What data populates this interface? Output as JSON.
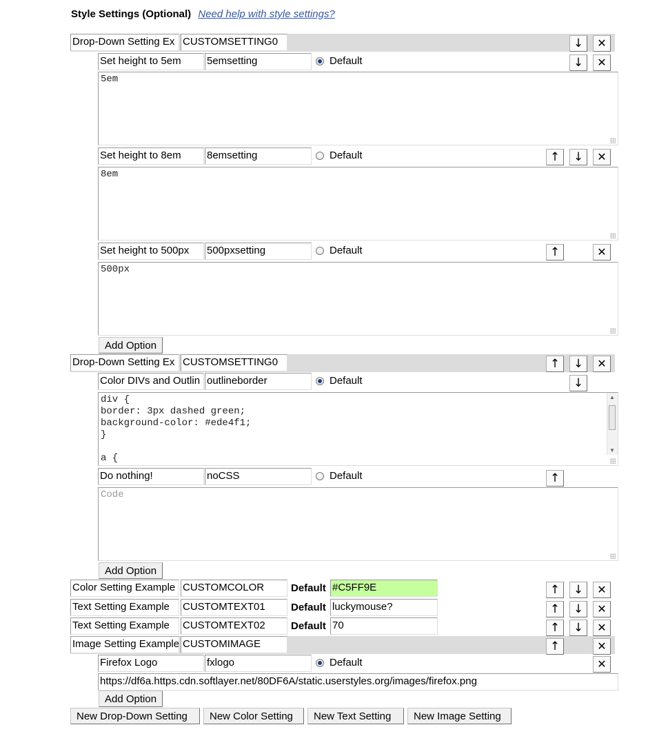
{
  "header": {
    "title": "Style Settings (Optional)",
    "help_link": "Need help with style settings?"
  },
  "dropdown1": {
    "label": "Drop-Down Setting Ex",
    "key": "CUSTOMSETTING0",
    "options": [
      {
        "label": "Set height to 5em",
        "key": "5emsetting",
        "default_label": "Default",
        "code": "5em"
      },
      {
        "label": "Set height to 8em",
        "key": "8emsetting",
        "default_label": "Default",
        "code": "8em"
      },
      {
        "label": "Set height to 500px",
        "key": "500pxsetting",
        "default_label": "Default",
        "code": "500px"
      }
    ],
    "add_option": "Add Option"
  },
  "dropdown2": {
    "label": "Drop-Down Setting Ex",
    "key": "CUSTOMSETTING0",
    "options": [
      {
        "label": "Color DIVs and Outlin",
        "key": "outlineborder",
        "default_label": "Default",
        "code": "div {\nborder: 3px dashed green;\nbackground-color: #ede4f1;\n}\n\na {"
      },
      {
        "label": "Do nothing!",
        "key": "noCSS",
        "default_label": "Default",
        "code_placeholder": "Code"
      }
    ],
    "add_option": "Add Option"
  },
  "simple_settings": [
    {
      "label": "Color Setting Example",
      "key": "CUSTOMCOLOR",
      "default_label": "Default",
      "value": "#C5FF9E"
    },
    {
      "label": "Text Setting Example",
      "key": "CUSTOMTEXT01",
      "default_label": "Default",
      "value": "luckymouse?"
    },
    {
      "label": "Text Setting Example",
      "key": "CUSTOMTEXT02",
      "default_label": "Default",
      "value": "70"
    }
  ],
  "image_setting": {
    "label": "Image Setting Example",
    "key": "CUSTOMIMAGE",
    "option": {
      "label": "Firefox Logo",
      "key": "fxlogo",
      "default_label": "Default",
      "url": "https://df6a.https.cdn.softlayer.net/80DF6A/static.userstyles.org/images/firefox.png"
    },
    "add_option": "Add Option"
  },
  "buttons": {
    "up": "↑",
    "down": "↓",
    "close": "✕",
    "new_dropdown": "New Drop-Down Setting",
    "new_color": "New Color Setting",
    "new_text": "New Text Setting",
    "new_image": "New Image Setting"
  },
  "colors": {
    "accent_link": "#3b5998",
    "color_value_bg": "#C5FF9E",
    "bar_gray": "#dcdcdc"
  }
}
